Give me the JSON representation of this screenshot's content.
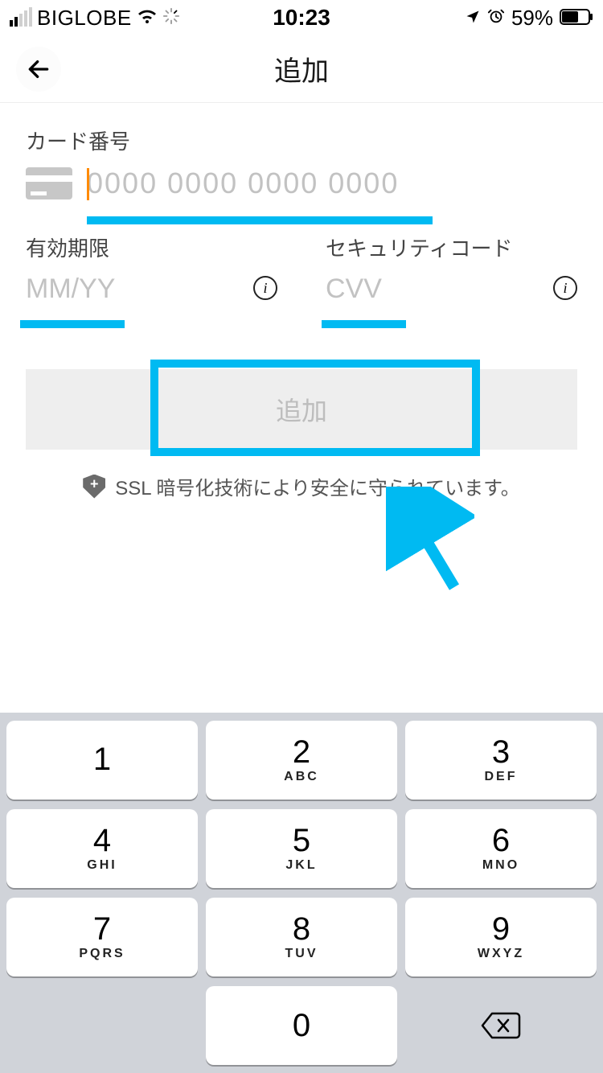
{
  "status": {
    "carrier": "BIGLOBE",
    "time": "10:23",
    "battery_pct": "59%"
  },
  "header": {
    "title": "追加"
  },
  "form": {
    "card_label": "カード番号",
    "card_placeholder": "0000 0000 0000 0000",
    "expiry_label": "有効期限",
    "expiry_placeholder": "MM/YY",
    "cvv_label": "セキュリティコード",
    "cvv_placeholder": "CVV",
    "submit_label": "追加",
    "ssl_note": "SSL 暗号化技術により安全に守られています。"
  },
  "keypad": {
    "keys": [
      {
        "num": "1",
        "letters": ""
      },
      {
        "num": "2",
        "letters": "ABC"
      },
      {
        "num": "3",
        "letters": "DEF"
      },
      {
        "num": "4",
        "letters": "GHI"
      },
      {
        "num": "5",
        "letters": "JKL"
      },
      {
        "num": "6",
        "letters": "MNO"
      },
      {
        "num": "7",
        "letters": "PQRS"
      },
      {
        "num": "8",
        "letters": "TUV"
      },
      {
        "num": "9",
        "letters": "WXYZ"
      },
      {
        "num": "0",
        "letters": ""
      }
    ]
  },
  "annotation": {
    "highlight_color": "#00baf2"
  }
}
